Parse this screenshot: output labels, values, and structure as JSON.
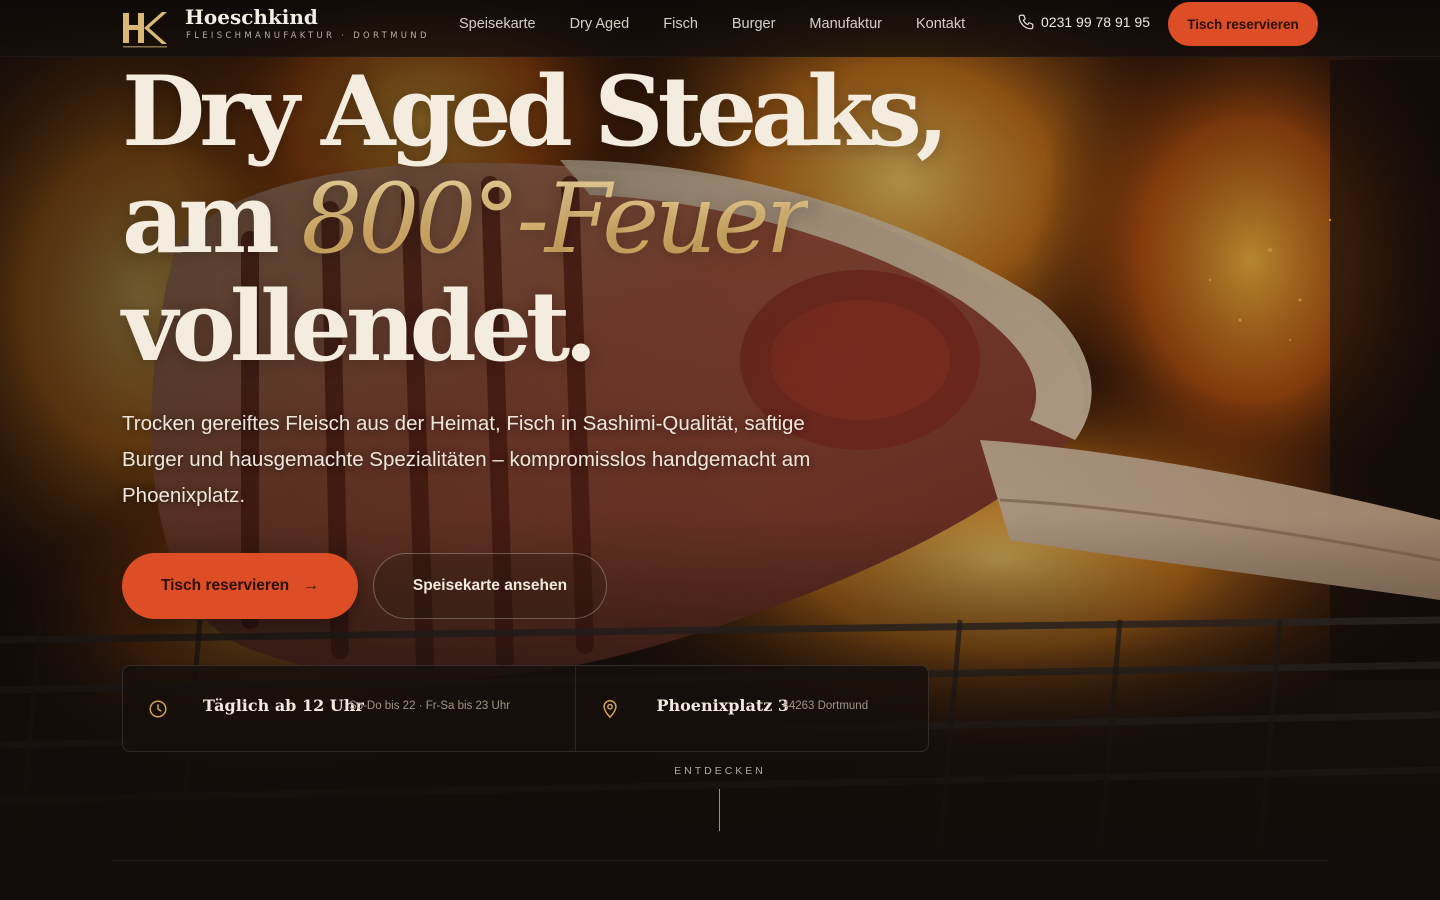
{
  "brand": {
    "name": "Hoeschkind",
    "tagline": "FLEISCHMANUFAKTUR · DORTMUND",
    "logo_letters": "HK"
  },
  "nav": {
    "links": [
      "Speisekarte",
      "Dry Aged",
      "Fisch",
      "Burger",
      "Manufaktur",
      "Kontakt"
    ],
    "phone": "0231 99 78 91 95",
    "phone_icon": "phone-icon",
    "cta": "Tisch reservieren"
  },
  "hero": {
    "headline_line1": "Dry Aged Steaks,",
    "headline_line2_start": "am ",
    "headline_line2_accent": "800°-Feuer",
    "headline_line3": "vollendet.",
    "subtext": "Trocken gereiftes Fleisch aus der Heimat, Fisch in Sashimi-Qualität, saftige Burger und hausgemachte Spezialitäten – kompromisslos handgemacht am Phoenixplatz.",
    "cta_primary": "Tisch reservieren",
    "cta_primary_arrow": "→",
    "cta_secondary": "Speisekarte ansehen"
  },
  "info": {
    "hours_title": "Täglich ab 12 Uhr",
    "hours_detail": "So-Do bis 22 · Fr-Sa bis 23 Uhr",
    "hours_icon": "clock-icon",
    "address_title": "Phoenixplatz 3",
    "address_detail": "44263 Dortmund",
    "address_icon": "map-pin-icon"
  },
  "scroll_hint": "ENTDECKEN",
  "colors": {
    "accent": "#dd4e26",
    "gold": "#e8c889",
    "background": "#120d0a",
    "text": "#f4ecdf"
  }
}
